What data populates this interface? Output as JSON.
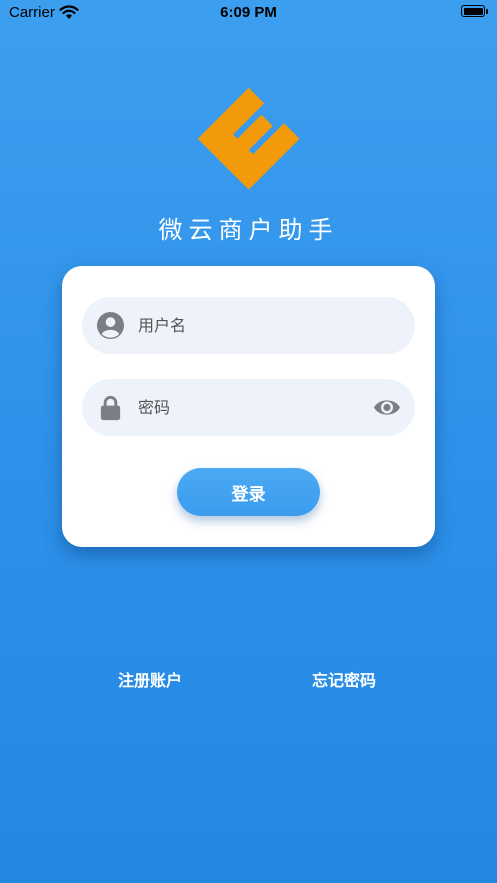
{
  "status_bar": {
    "carrier": "Carrier",
    "time": "6:09 PM"
  },
  "logo": {
    "letter": "E",
    "color": "#f39a0b"
  },
  "app_title": "微云商户助手",
  "login_form": {
    "username_placeholder": "用户名",
    "password_placeholder": "密码",
    "login_label": "登录"
  },
  "links": {
    "register": "注册账户",
    "forgot_password": "忘记密码"
  },
  "icons": [
    "wifi-icon",
    "battery-icon",
    "user-icon",
    "lock-icon",
    "eye-icon"
  ],
  "colors": {
    "background": "#3296eb",
    "accent": "#4ba9f3",
    "field_bg": "#eef3fb",
    "logo": "#f39a0b"
  }
}
